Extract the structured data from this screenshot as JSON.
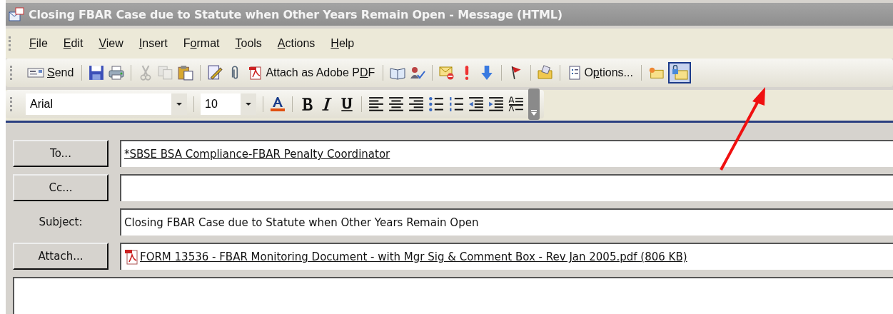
{
  "window": {
    "title": "Closing FBAR Case due to Statute when Other Years Remain Open - Message (HTML)"
  },
  "menu": [
    {
      "key": "F",
      "after": "ile"
    },
    {
      "key": "E",
      "after": "dit"
    },
    {
      "key": "V",
      "after": "iew"
    },
    {
      "key": "I",
      "after": "nsert"
    },
    {
      "before": "F",
      "key": "o",
      "after": "rmat"
    },
    {
      "key": "T",
      "after": "ools"
    },
    {
      "key": "A",
      "after": "ctions"
    },
    {
      "key": "H",
      "after": "elp"
    }
  ],
  "standard_toolbar": {
    "send": {
      "key": "S",
      "after": "end"
    },
    "cut_disabled": true,
    "copy_disabled": true,
    "attach_pdf": {
      "before": "Attach as Adobe P",
      "key": "D",
      "after": "F"
    },
    "options": {
      "before": "O",
      "key": "p",
      "after": "tions..."
    },
    "encrypt_pressed": true
  },
  "format_toolbar": {
    "font": "Arial",
    "size": "10"
  },
  "fields": [
    {
      "kind": "button",
      "label": "To...",
      "value": "*SBSE BSA Compliance-FBAR Penalty Coordinator",
      "link": true
    },
    {
      "kind": "button",
      "label": "Cc..."
    },
    {
      "kind": "label",
      "label": "Subject:",
      "value": "Closing FBAR Case due to Statute when Other Years Remain Open",
      "link": false
    },
    {
      "kind": "attach",
      "label": "Attach...",
      "value": "FORM 13536 - FBAR Monitoring Document - with Mgr Sig & Comment Box - Rev Jan 2005.pdf (806 KB)",
      "link": true
    }
  ]
}
